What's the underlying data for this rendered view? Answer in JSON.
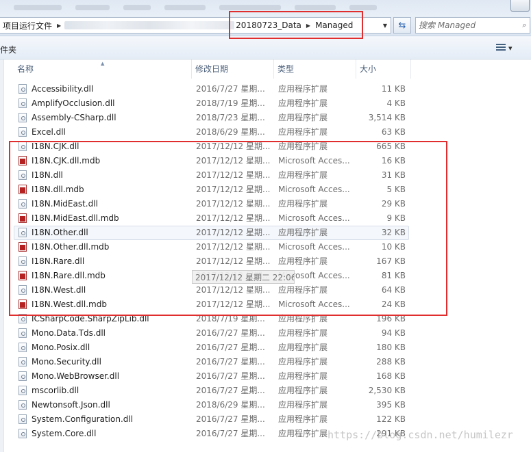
{
  "breadcrumb": {
    "first": "项目运行文件",
    "data_folder": "20180723_Data",
    "current": "Managed"
  },
  "search": {
    "placeholder": "搜索 Managed"
  },
  "toolbar": {
    "label": "件夹"
  },
  "columns": {
    "name": "名称",
    "date": "修改日期",
    "type": "类型",
    "size": "大小"
  },
  "files": [
    {
      "name": "Accessibility.dll",
      "date": "2016/7/27 星期...",
      "type": "应用程序扩展",
      "size": "11 KB",
      "kind": "dll"
    },
    {
      "name": "AmplifyOcclusion.dll",
      "date": "2018/7/19 星期...",
      "type": "应用程序扩展",
      "size": "4 KB",
      "kind": "dll"
    },
    {
      "name": "Assembly-CSharp.dll",
      "date": "2018/7/23 星期...",
      "type": "应用程序扩展",
      "size": "3,514 KB",
      "kind": "dll"
    },
    {
      "name": "Excel.dll",
      "date": "2018/6/29 星期...",
      "type": "应用程序扩展",
      "size": "63 KB",
      "kind": "dll"
    },
    {
      "name": "I18N.CJK.dll",
      "date": "2017/12/12 星期...",
      "type": "应用程序扩展",
      "size": "665 KB",
      "kind": "dll"
    },
    {
      "name": "I18N.CJK.dll.mdb",
      "date": "2017/12/12 星期...",
      "type": "Microsoft Acces...",
      "size": "16 KB",
      "kind": "mdb"
    },
    {
      "name": "I18N.dll",
      "date": "2017/12/12 星期...",
      "type": "应用程序扩展",
      "size": "31 KB",
      "kind": "dll"
    },
    {
      "name": "I18N.dll.mdb",
      "date": "2017/12/12 星期...",
      "type": "Microsoft Acces...",
      "size": "5 KB",
      "kind": "mdb"
    },
    {
      "name": "I18N.MidEast.dll",
      "date": "2017/12/12 星期...",
      "type": "应用程序扩展",
      "size": "29 KB",
      "kind": "dll"
    },
    {
      "name": "I18N.MidEast.dll.mdb",
      "date": "2017/12/12 星期...",
      "type": "Microsoft Acces...",
      "size": "9 KB",
      "kind": "mdb"
    },
    {
      "name": "I18N.Other.dll",
      "date": "2017/12/12 星期...",
      "type": "应用程序扩展",
      "size": "32 KB",
      "kind": "dll",
      "hovered": true
    },
    {
      "name": "I18N.Other.dll.mdb",
      "date": "2017/12/12 星期...",
      "type": "Microsoft Acces...",
      "size": "10 KB",
      "kind": "mdb"
    },
    {
      "name": "I18N.Rare.dll",
      "date": "2017/12/12 星期...",
      "type": "应用程序扩展",
      "size": "167 KB",
      "kind": "dll"
    },
    {
      "name": "I18N.Rare.dll.mdb",
      "date": "2017/12/12 星期...",
      "type": "Microsoft Acces...",
      "size": "81 KB",
      "kind": "mdb"
    },
    {
      "name": "I18N.West.dll",
      "date": "2017/12/12 星期...",
      "type": "应用程序扩展",
      "size": "64 KB",
      "kind": "dll"
    },
    {
      "name": "I18N.West.dll.mdb",
      "date": "2017/12/12 星期...",
      "type": "Microsoft Acces...",
      "size": "24 KB",
      "kind": "mdb"
    },
    {
      "name": "ICSharpCode.SharpZipLib.dll",
      "date": "2018/7/19 星期...",
      "type": "应用程序扩展",
      "size": "196 KB",
      "kind": "dll"
    },
    {
      "name": "Mono.Data.Tds.dll",
      "date": "2016/7/27 星期...",
      "type": "应用程序扩展",
      "size": "94 KB",
      "kind": "dll"
    },
    {
      "name": "Mono.Posix.dll",
      "date": "2016/7/27 星期...",
      "type": "应用程序扩展",
      "size": "180 KB",
      "kind": "dll"
    },
    {
      "name": "Mono.Security.dll",
      "date": "2016/7/27 星期...",
      "type": "应用程序扩展",
      "size": "288 KB",
      "kind": "dll"
    },
    {
      "name": "Mono.WebBrowser.dll",
      "date": "2016/7/27 星期...",
      "type": "应用程序扩展",
      "size": "168 KB",
      "kind": "dll"
    },
    {
      "name": "mscorlib.dll",
      "date": "2016/7/27 星期...",
      "type": "应用程序扩展",
      "size": "2,530 KB",
      "kind": "dll"
    },
    {
      "name": "Newtonsoft.Json.dll",
      "date": "2018/6/29 星期...",
      "type": "应用程序扩展",
      "size": "395 KB",
      "kind": "dll"
    },
    {
      "name": "System.Configuration.dll",
      "date": "2016/7/27 星期...",
      "type": "应用程序扩展",
      "size": "122 KB",
      "kind": "dll"
    },
    {
      "name": "System.Core.dll",
      "date": "2016/7/27 星期...",
      "type": "应用程序扩展",
      "size": "291 KB",
      "kind": "dll"
    }
  ],
  "tooltip": {
    "text": "2017/12/12 星期二 22:06"
  },
  "watermark": "https://blog.csdn.net/humilezr",
  "colors": {
    "annotation_red": "#e02d2d",
    "secondary_text": "#6d6d6d"
  }
}
